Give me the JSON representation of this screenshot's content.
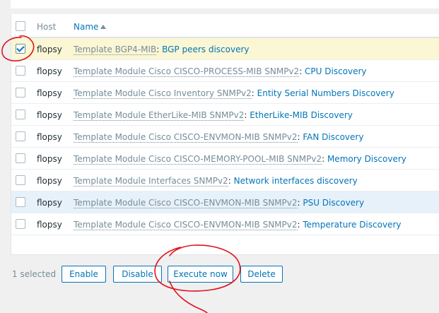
{
  "table": {
    "columns": {
      "host": "Host",
      "name": "Name"
    },
    "rows": [
      {
        "host": "flopsy",
        "template": "Template BGP4-MIB",
        "rule": "BGP peers discovery",
        "checked": true
      },
      {
        "host": "flopsy",
        "template": "Template Module Cisco CISCO-PROCESS-MIB SNMPv2",
        "rule": "CPU Discovery",
        "checked": false
      },
      {
        "host": "flopsy",
        "template": "Template Module Cisco Inventory SNMPv2",
        "rule": "Entity Serial Numbers Discovery",
        "checked": false
      },
      {
        "host": "flopsy",
        "template": "Template Module EtherLike-MIB SNMPv2",
        "rule": "EtherLike-MIB Discovery",
        "checked": false
      },
      {
        "host": "flopsy",
        "template": "Template Module Cisco CISCO-ENVMON-MIB SNMPv2",
        "rule": "FAN Discovery",
        "checked": false
      },
      {
        "host": "flopsy",
        "template": "Template Module Cisco CISCO-MEMORY-POOL-MIB SNMPv2",
        "rule": "Memory Discovery",
        "checked": false
      },
      {
        "host": "flopsy",
        "template": "Template Module Interfaces SNMPv2",
        "rule": "Network interfaces discovery",
        "checked": false
      },
      {
        "host": "flopsy",
        "template": "Template Module Cisco CISCO-ENVMON-MIB SNMPv2",
        "rule": "PSU Discovery",
        "checked": false
      },
      {
        "host": "flopsy",
        "template": "Template Module Cisco CISCO-ENVMON-MIB SNMPv2",
        "rule": "Temperature Discovery",
        "checked": false
      }
    ]
  },
  "footer": {
    "selected_count": "1 selected",
    "buttons": {
      "enable": "Enable",
      "disable": "Disable",
      "execute": "Execute now",
      "delete": "Delete"
    }
  },
  "colors": {
    "accent": "#0275b8",
    "selected_row": "#fbf6d3",
    "hover_row": "#e7f1fa",
    "annotation": "#e0141e"
  },
  "separator": ": "
}
